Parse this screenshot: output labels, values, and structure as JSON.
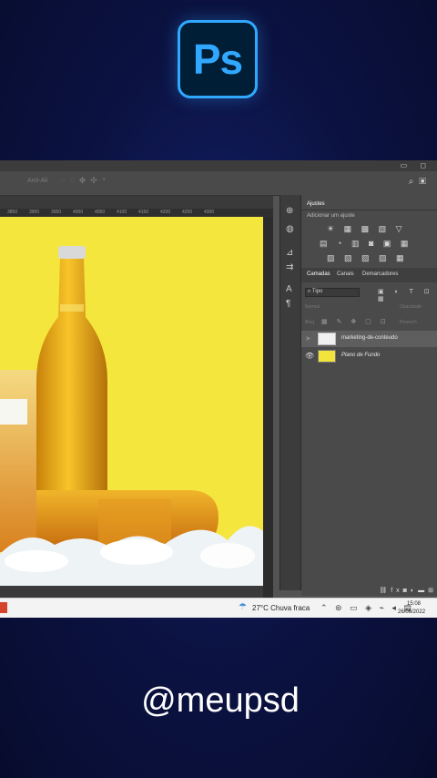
{
  "logo": {
    "text": "Ps"
  },
  "options_bar": {
    "items": [
      "Anti-Ali"
    ],
    "right_icons": [
      "search-icon",
      "workspace-icon"
    ]
  },
  "ruler": {
    "ticks": [
      "3850",
      "3900",
      "3950",
      "4000",
      "4050",
      "4100",
      "4150",
      "4200",
      "4250",
      "4300"
    ]
  },
  "adjustments_panel": {
    "tab": "Ajustes",
    "subtitle": "Adicionar um ajuste"
  },
  "layers_panel": {
    "tabs": [
      "Camadas",
      "Canais",
      "Demarcadores"
    ],
    "filter_label": "Tipo",
    "mode_label": "Normal",
    "opacity_label": "Opacidade",
    "lock_label": "Bloq",
    "fill_label": "Preench",
    "layers": [
      {
        "name": "marketing-de-conteudo",
        "selected": true
      },
      {
        "name": "Plano de Fundo",
        "selected": false
      }
    ],
    "bottom_icons": [
      "link-icon",
      "fx-icon",
      "mask-icon",
      "adjustment-icon",
      "folder-icon",
      "new-layer-icon"
    ]
  },
  "taskbar": {
    "weather": "27°C  Chuva fraca",
    "time": "15:08",
    "date": "26/06/2022"
  },
  "caption": {
    "handle": "@meupsd"
  },
  "colors": {
    "background": "#0b1240",
    "ps_accent": "#31a8ff",
    "canvas_yellow": "#f2e43a"
  }
}
